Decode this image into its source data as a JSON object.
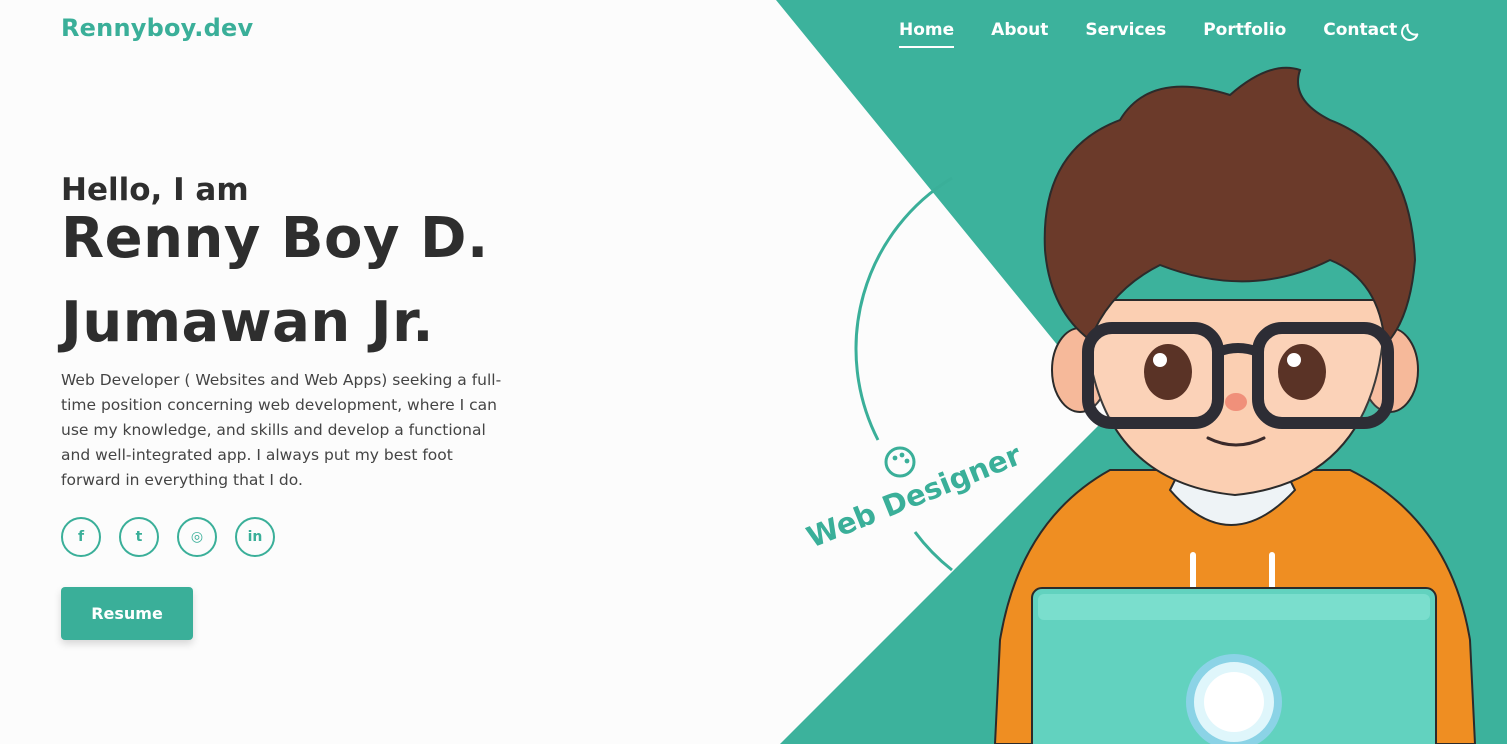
{
  "header": {
    "brand": "Rennyboy.dev",
    "nav": [
      {
        "label": "Home",
        "active": true
      },
      {
        "label": "About",
        "active": false
      },
      {
        "label": "Services",
        "active": false
      },
      {
        "label": "Portfolio",
        "active": false
      },
      {
        "label": "Contact",
        "active": false
      }
    ],
    "theme_toggle_icon": "moon-icon"
  },
  "hero": {
    "greeting": "Hello, I am",
    "name_line_1": "Renny Boy D.",
    "name_line_2": "Jumawan Jr.",
    "bio": "Web Developer ( Websites and Web Apps) seeking a full-time position concerning web development, where I can use my knowledge, and skills and develop a functional and well-integrated app. I always put my best foot forward in everything that I do.",
    "socials": [
      {
        "icon": "facebook-icon",
        "glyph": "f"
      },
      {
        "icon": "twitter-icon",
        "glyph": "t"
      },
      {
        "icon": "instagram-icon",
        "glyph": "◎"
      },
      {
        "icon": "linkedin-icon",
        "glyph": "in"
      }
    ],
    "resume_label": "Resume",
    "badge_label": "Web Designer",
    "badge_icon": "palette-icon"
  },
  "colors": {
    "accent": "#3aaf99",
    "text_dark": "#2e2e2e",
    "background": "#fcfcfc"
  }
}
